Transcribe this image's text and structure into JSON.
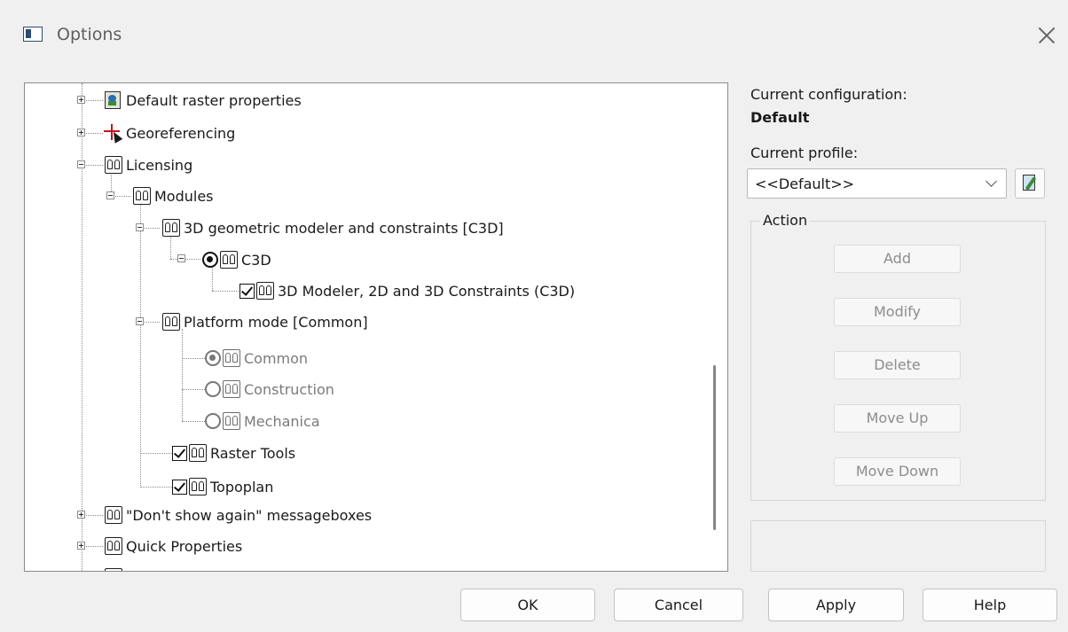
{
  "window": {
    "title": "Options"
  },
  "tree": {
    "items": [
      {
        "label": "Default raster properties"
      },
      {
        "label": "Georeferencing"
      },
      {
        "label": "Licensing"
      },
      {
        "label": "Modules"
      },
      {
        "label": "3D geometric modeler and constraints [C3D]"
      },
      {
        "label": "C3D"
      },
      {
        "label": "3D Modeler, 2D and 3D Constraints (C3D)"
      },
      {
        "label": "Platform mode [Common]"
      },
      {
        "label": "Common"
      },
      {
        "label": "Construction"
      },
      {
        "label": "Mechanica"
      },
      {
        "label": "Raster Tools"
      },
      {
        "label": "Topoplan"
      },
      {
        "label": "\"Don't show again\" messageboxes"
      },
      {
        "label": "Quick Properties"
      }
    ]
  },
  "config": {
    "label": "Current configuration:",
    "value": "Default",
    "profile_label": "Current profile:",
    "profile_value": "<<Default>>"
  },
  "action": {
    "title": "Action",
    "buttons": [
      "Add",
      "Modify",
      "Delete",
      "Move Up",
      "Move Down"
    ]
  },
  "footer": {
    "ok": "OK",
    "cancel": "Cancel",
    "apply": "Apply",
    "help": "Help"
  }
}
